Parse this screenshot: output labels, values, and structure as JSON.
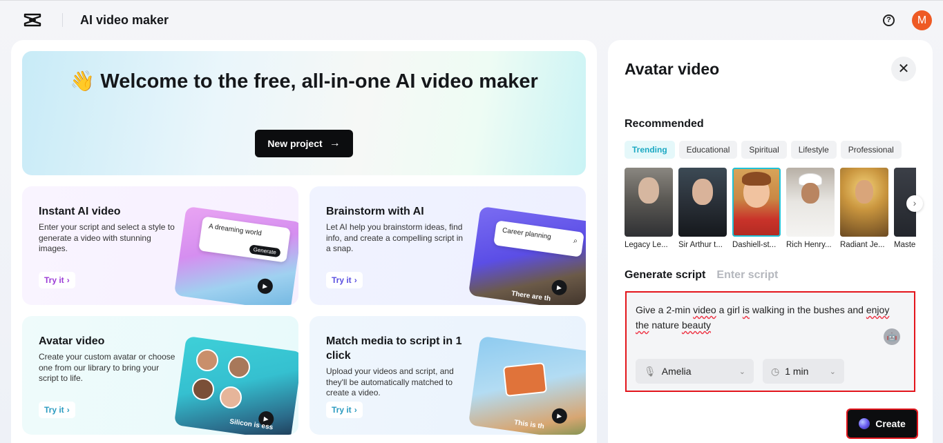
{
  "header": {
    "title": "AI video maker",
    "avatar_letter": "M",
    "help_symbol": "?"
  },
  "hero": {
    "emoji": "👋",
    "title": "Welcome to the free, all-in-one AI video maker",
    "button_label": "New project"
  },
  "cards": [
    {
      "title": "Instant AI video",
      "description": "Enter your script and select a style to generate a video with stunning images.",
      "try_label": "Try it",
      "art_text": "A dreaming world",
      "art_button": "Generate"
    },
    {
      "title": "Brainstorm with AI",
      "description": "Let AI help you brainstorm ideas, find info, and create a compelling script in a snap.",
      "try_label": "Try it",
      "art_text": "Career planning",
      "art_caption": "There are th"
    },
    {
      "title": "Avatar video",
      "description": "Create your custom avatar or choose one from our library to bring your script to life.",
      "try_label": "Try it",
      "art_caption": "Silicon is ess"
    },
    {
      "title": "Match media to script in 1 click",
      "description": "Upload your videos and script, and they'll be automatically matched to create a video.",
      "try_label": "Try it",
      "art_caption": "This is th"
    }
  ],
  "panel": {
    "title": "Avatar video",
    "recommended_label": "Recommended",
    "categories": [
      "Trending",
      "Educational",
      "Spiritual",
      "Lifestyle",
      "Professional"
    ],
    "active_category": "Trending",
    "avatars": [
      {
        "name": "Legacy Le..."
      },
      {
        "name": "Sir Arthur t..."
      },
      {
        "name": "Dashiell-st..."
      },
      {
        "name": "Rich Henry..."
      },
      {
        "name": "Radiant Je..."
      },
      {
        "name": "Maste"
      }
    ],
    "selected_avatar": "Dashiell-st...",
    "tabs": {
      "generate": "Generate script",
      "enter": "Enter script"
    },
    "script_text_parts": {
      "p1": "Give a 2-min",
      "p2": "video",
      "p3": " a girl ",
      "p4": "is",
      "p5": " walking in the bushes and ",
      "p6": "enjoy",
      "p7": "the",
      "p8": " nature ",
      "p9": "beauty"
    },
    "voice": "Amelia",
    "duration": "1 min",
    "create_label": "Create"
  },
  "colors": {
    "accent_teal": "#1aa8c2",
    "highlight_red": "#e3141b",
    "avatar_orange": "#ee5a24"
  }
}
